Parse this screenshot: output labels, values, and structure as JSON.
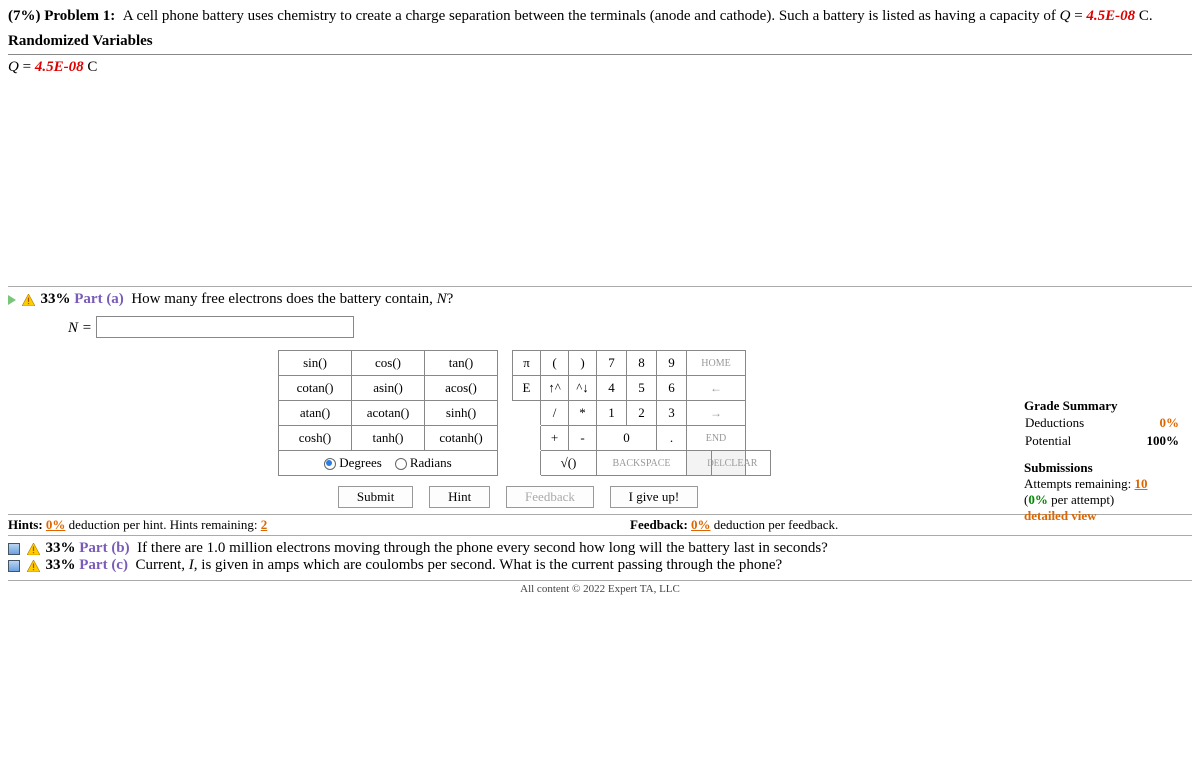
{
  "problem": {
    "weight": "(7%)",
    "label": "Problem 1:",
    "text_prefix": "A cell phone battery uses chemistry to create a charge separation between the terminals (anode and cathode). Such a battery is listed as having a capacity of ",
    "q_var": "Q",
    "q_eq": " = ",
    "q_val": "4.5E-08",
    "q_unit": " C."
  },
  "rand_vars": {
    "heading": "Randomized Variables",
    "line_var": "Q",
    "line_eq": " = ",
    "line_val": "4.5E-08",
    "line_unit": " C"
  },
  "part_a": {
    "pct": "33%",
    "label": "Part (a)",
    "question": "How many free electrons does the battery contain, ",
    "question_var": "N",
    "question_tail": "?",
    "answer_label": "N = "
  },
  "funcs": {
    "r1c1": "sin()",
    "r1c2": "cos()",
    "r1c3": "tan()",
    "r2c1": "cotan()",
    "r2c2": "asin()",
    "r2c3": "acos()",
    "r3c1": "atan()",
    "r3c2": "acotan()",
    "r3c3": "sinh()",
    "r4c1": "cosh()",
    "r4c2": "tanh()",
    "r4c3": "cotanh()",
    "deg": "Degrees",
    "rad": "Radians"
  },
  "nums": {
    "pi": "π",
    "lp": "(",
    "rp": ")",
    "n7": "7",
    "n8": "8",
    "n9": "9",
    "home": "HOME",
    "E": "E",
    "up": "↑^",
    "dn": "^↓",
    "n4": "4",
    "n5": "5",
    "n6": "6",
    "left": "←",
    "slash": "/",
    "star": "*",
    "n1": "1",
    "n2": "2",
    "n3": "3",
    "right": "→",
    "plus": "+",
    "minus": "-",
    "n0": "0",
    "dot": ".",
    "end": "END",
    "sqrt": "√()",
    "bksp": "BACKSPACE",
    "del": "DEL",
    "clear": "CLEAR"
  },
  "buttons": {
    "submit": "Submit",
    "hint": "Hint",
    "feedback": "Feedback",
    "giveup": "I give up!"
  },
  "hints": {
    "label": "Hints:",
    "pct": "0%",
    "text": " deduction per hint. Hints remaining: ",
    "remaining": "2",
    "fb_label": "Feedback:",
    "fb_pct": "0%",
    "fb_text": " deduction per feedback."
  },
  "grade": {
    "title": "Grade Summary",
    "ded_label": "Deductions",
    "ded_val": "0%",
    "pot_label": "Potential",
    "pot_val": "100%",
    "subs_title": "Submissions",
    "attempts_label": "Attempts remaining: ",
    "attempts_val": "10",
    "per_label_open": "(",
    "per_pct": "0%",
    "per_label_close": " per attempt)",
    "detailed": "detailed view"
  },
  "parts_bc": {
    "b_pct": "33%",
    "b_label": "Part (b)",
    "b_text": "If there are 1.0 million electrons moving through the phone every second how long will the battery last in seconds?",
    "c_pct": "33%",
    "c_label": "Part (c)",
    "c_text": "Current, ",
    "c_var": "I",
    "c_text2": ", is given in amps which are coulombs per second. What is the current passing through the phone?"
  },
  "footer": "All content © 2022 Expert TA, LLC"
}
